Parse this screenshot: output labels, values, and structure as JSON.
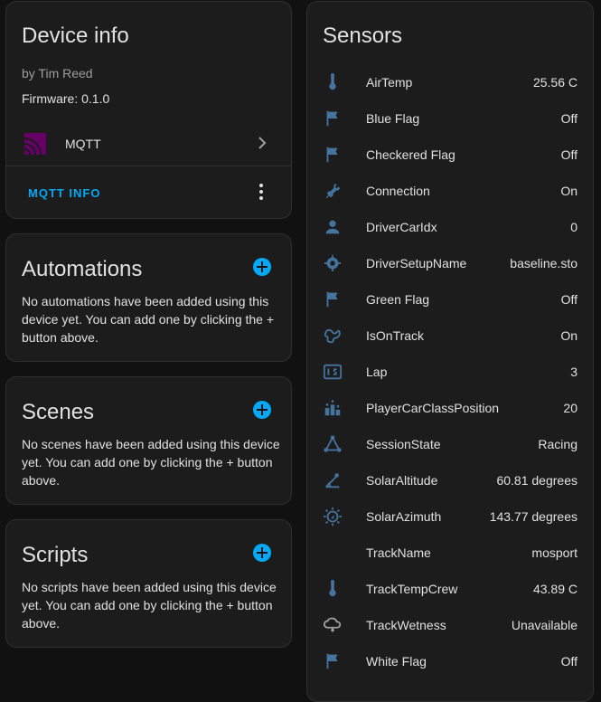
{
  "device": {
    "title": "Device info",
    "by": "by Tim Reed",
    "firmware": "Firmware: 0.1.0",
    "integration_label": "MQTT",
    "info_button": "MQTT INFO"
  },
  "automations": {
    "title": "Automations",
    "description": "No automations have been added using this device yet. You can add one by clicking the + button above."
  },
  "scenes": {
    "title": "Scenes",
    "description": "No scenes have been added using this device yet. You can add one by clicking the + button above."
  },
  "scripts": {
    "title": "Scripts",
    "description": "No scripts have been added using this device yet. You can add one by clicking the + button above."
  },
  "sensors": {
    "title": "Sensors",
    "items": [
      {
        "name": "AirTemp",
        "value": "25.56 C",
        "icon": "thermometer-icon"
      },
      {
        "name": "Blue Flag",
        "value": "Off",
        "icon": "flag-icon"
      },
      {
        "name": "Checkered Flag",
        "value": "Off",
        "icon": "flag-icon"
      },
      {
        "name": "Connection",
        "value": "On",
        "icon": "plug-icon"
      },
      {
        "name": "DriverCarIdx",
        "value": "0",
        "icon": "person-icon"
      },
      {
        "name": "DriverSetupName",
        "value": "baseline.sto",
        "icon": "gear-icon"
      },
      {
        "name": "Green Flag",
        "value": "Off",
        "icon": "flag-icon"
      },
      {
        "name": "IsOnTrack",
        "value": "On",
        "icon": "track-icon"
      },
      {
        "name": "Lap",
        "value": "3",
        "icon": "counter-icon"
      },
      {
        "name": "PlayerCarClassPosition",
        "value": "20",
        "icon": "podium-icon"
      },
      {
        "name": "SessionState",
        "value": "Racing",
        "icon": "graph-icon"
      },
      {
        "name": "SolarAltitude",
        "value": "60.81 degrees",
        "icon": "sun-angle-icon"
      },
      {
        "name": "SolarAzimuth",
        "value": "143.77 degrees",
        "icon": "sun-compass-icon"
      },
      {
        "name": "TrackName",
        "value": "mosport",
        "icon": "none"
      },
      {
        "name": "TrackTempCrew",
        "value": "43.89 C",
        "icon": "thermometer-icon"
      },
      {
        "name": "TrackWetness",
        "value": "Unavailable",
        "icon": "cloud-rain-icon"
      },
      {
        "name": "White Flag",
        "value": "Off",
        "icon": "flag-icon"
      }
    ]
  },
  "colors": {
    "accent": "#03a9f4",
    "icon": "#44739e",
    "mqtt_logo": "#660066"
  }
}
